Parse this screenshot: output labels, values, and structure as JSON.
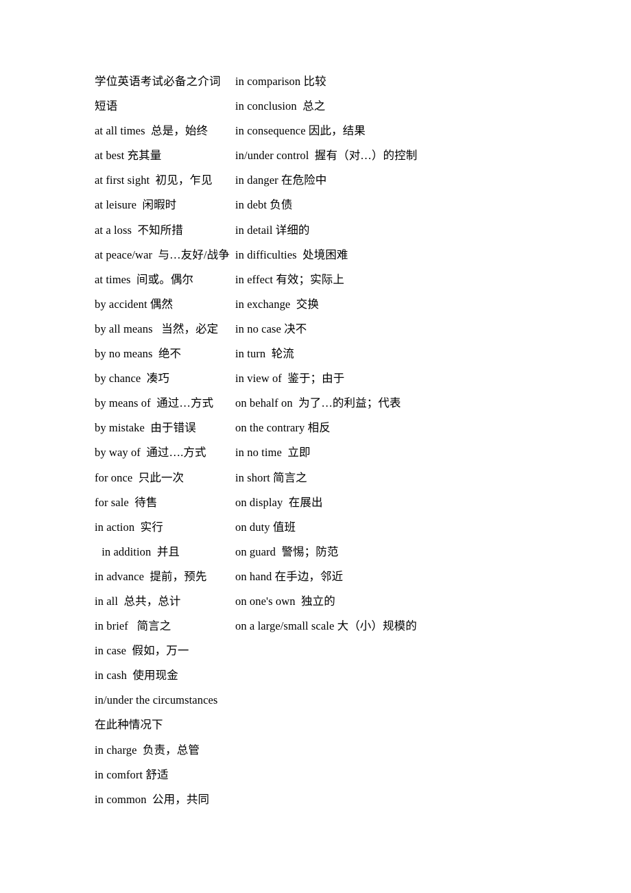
{
  "document": {
    "title": "学位英语考试必备之介词短语",
    "language": "zh-CN",
    "background_color": "#ffffff",
    "text_color": "#000000"
  },
  "columns": {
    "left": {
      "entries": [
        {
          "text": "学位英语考试必备之介词短语",
          "style": "title"
        },
        {
          "text": "at all times  总是，始终",
          "style": "normal"
        },
        {
          "text": "at best 充其量",
          "style": "normal"
        },
        {
          "text": "at first sight  初见，乍见",
          "style": "normal"
        },
        {
          "text": "at leisure  闲暇时",
          "style": "normal"
        },
        {
          "text": "at a loss  不知所措",
          "style": "normal"
        },
        {
          "text": "at peace/war  与…友好/战争",
          "style": "normal"
        },
        {
          "text": "at times  间或。偶尔",
          "style": "normal"
        },
        {
          "text": "by accident 偶然",
          "style": "normal"
        },
        {
          "text": "by all means   当然，必定",
          "style": "normal"
        },
        {
          "text": "by no means  绝不",
          "style": "normal"
        },
        {
          "text": "by chance  凑巧",
          "style": "normal"
        },
        {
          "text": "by means of  通过…方式",
          "style": "normal"
        },
        {
          "text": "by mistake  由于错误",
          "style": "normal"
        },
        {
          "text": "by way of  通过….方式",
          "style": "normal"
        },
        {
          "text": "for once  只此一次",
          "style": "normal"
        },
        {
          "text": "for sale  待售",
          "style": "normal"
        },
        {
          "text": "in action  实行",
          "style": "normal"
        },
        {
          "text": " in addition  并且",
          "style": "indented"
        },
        {
          "text": "in advance  提前，预先",
          "style": "normal"
        },
        {
          "text": "in all  总共，总计",
          "style": "normal"
        },
        {
          "text": "in brief   简言之",
          "style": "normal"
        },
        {
          "text": "in case  假如，万一",
          "style": "normal"
        },
        {
          "text": "in cash  使用现金",
          "style": "normal"
        },
        {
          "text": "in/under the circumstances 在此种情况下",
          "style": "wraps"
        },
        {
          "text": "in charge  负责，总管",
          "style": "normal"
        },
        {
          "text": "in comfort 舒适",
          "style": "normal"
        },
        {
          "text": "in common  公用，共同",
          "style": "normal"
        }
      ]
    },
    "right": {
      "entries": [
        {
          "text": "in comparison 比较",
          "style": "normal"
        },
        {
          "text": "in conclusion  总之",
          "style": "normal"
        },
        {
          "text": "in consequence 因此，结果",
          "style": "normal"
        },
        {
          "text": "in/under control  握有（对…）的控制",
          "style": "normal"
        },
        {
          "text": "in danger 在危险中",
          "style": "normal"
        },
        {
          "text": "in debt 负债",
          "style": "normal"
        },
        {
          "text": "in detail 详细的",
          "style": "normal"
        },
        {
          "text": "in difficulties  处境困难",
          "style": "normal"
        },
        {
          "text": "in effect 有效；实际上",
          "style": "normal"
        },
        {
          "text": "in exchange  交换",
          "style": "normal"
        },
        {
          "text": "in no case 决不",
          "style": "normal"
        },
        {
          "text": "in turn  轮流",
          "style": "normal"
        },
        {
          "text": "in view of  鉴于；由于",
          "style": "normal"
        },
        {
          "text": "on behalf on  为了…的利益；代表",
          "style": "normal"
        },
        {
          "text": "on the contrary 相反",
          "style": "normal"
        },
        {
          "text": "in no time  立即",
          "style": "normal"
        },
        {
          "text": "in short 简言之",
          "style": "normal"
        },
        {
          "text": "on display  在展出",
          "style": "normal"
        },
        {
          "text": "on duty 值班",
          "style": "normal"
        },
        {
          "text": "on guard  警惕；防范",
          "style": "normal"
        },
        {
          "text": "on hand 在手边，邻近",
          "style": "normal"
        },
        {
          "text": "on one's own  独立的",
          "style": "normal"
        },
        {
          "text": "on a large/small scale 大（小）规模的",
          "style": "normal"
        }
      ]
    }
  }
}
